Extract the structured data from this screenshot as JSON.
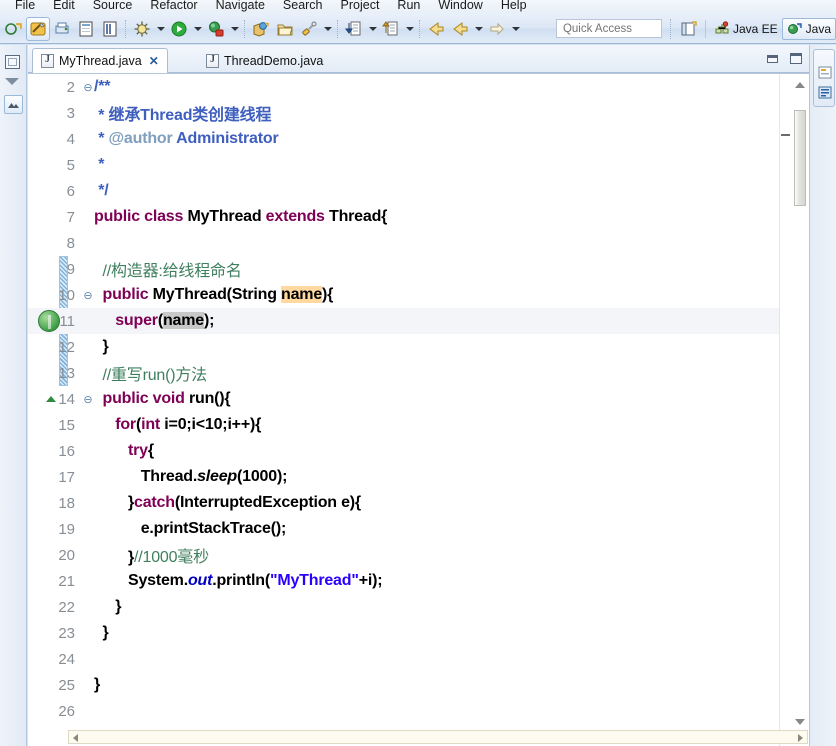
{
  "menu": {
    "items": [
      "File",
      "Edit",
      "Source",
      "Refactor",
      "Navigate",
      "Search",
      "Project",
      "Run",
      "Window",
      "Help"
    ]
  },
  "toolbar": {
    "icons": [
      {
        "name": "new-wizard-icon",
        "glyph": "new"
      },
      {
        "name": "save-icon",
        "glyph": "save"
      },
      {
        "name": "print-icon",
        "glyph": "print"
      },
      {
        "name": "new-java-project-icon",
        "glyph": "project"
      },
      {
        "name": "new-java-package-icon",
        "glyph": "package"
      },
      {
        "name": "debug-icon",
        "glyph": "debug"
      },
      {
        "name": "run-icon",
        "glyph": "run"
      },
      {
        "name": "external-tools-icon",
        "glyph": "external"
      },
      {
        "name": "new-java-class-icon",
        "glyph": "class"
      },
      {
        "name": "open-type-icon",
        "glyph": "opentype"
      },
      {
        "name": "search-icon",
        "glyph": "search"
      },
      {
        "name": "next-annotation-icon",
        "glyph": "next-anno"
      },
      {
        "name": "previous-annotation-icon",
        "glyph": "prev-anno"
      },
      {
        "name": "back-icon",
        "glyph": "back"
      },
      {
        "name": "forward-icon",
        "glyph": "forward"
      },
      {
        "name": "next-edit-icon",
        "glyph": "next-edit"
      }
    ],
    "quick_access_placeholder": "Quick Access"
  },
  "perspectives": {
    "open_perspective_label": "",
    "items": [
      {
        "name": "java-ee-perspective",
        "label": "Java EE",
        "active": false
      },
      {
        "name": "java-perspective",
        "label": "Java",
        "active": true
      }
    ]
  },
  "editor": {
    "tabs": [
      {
        "label": "MyThread.java",
        "active": true,
        "close": "✕"
      },
      {
        "label": "ThreadDemo.java",
        "active": false,
        "close": ""
      }
    ],
    "tab_tools": [
      {
        "name": "minimize-editor-button",
        "title": "Minimize"
      },
      {
        "name": "maximize-editor-button",
        "title": "Maximize"
      }
    ]
  },
  "code": {
    "lines": [
      {
        "num": "2",
        "fold": "⊖",
        "html": "<span class=\"jdoc\">/**</span>"
      },
      {
        "num": "3",
        "fold": "",
        "html": "<span class=\"jdoc\"> * 继承Thread类创建线程</span>"
      },
      {
        "num": "4",
        "fold": "",
        "html": "<span class=\"jdoc\"> * </span><span class=\"jtag\">@author</span><span class=\"jdoc\"> Administrator</span>"
      },
      {
        "num": "5",
        "fold": "",
        "html": "<span class=\"jdoc\"> *</span>"
      },
      {
        "num": "6",
        "fold": "",
        "html": "<span class=\"jdoc\"> */</span>"
      },
      {
        "num": "7",
        "fold": "",
        "html": "<span class=\"kw\">public class</span><span class=\"id\"> MyThread </span><span class=\"kw\">extends</span><span class=\"id\"> Thread{</span>"
      },
      {
        "num": "8",
        "fold": "",
        "html": ""
      },
      {
        "num": "9",
        "fold": "",
        "html": "  <span class=\"cmt\">//构造器:给线程命名</span>"
      },
      {
        "num": "10",
        "fold": "⊖",
        "html": "  <span class=\"kw\">public</span><span class=\"id\"> MyThread(String </span><span class=\"id hl-occ\">name</span><span class=\"id\">){</span>"
      },
      {
        "num": "11",
        "fold": "",
        "html": "     <span class=\"kw\">super</span><span class=\"id\">(</span><span class=\"id hl-sel\">name</span><span class=\"id\">);</span>"
      },
      {
        "num": "12",
        "fold": "",
        "html": "  <span class=\"id\">}</span>"
      },
      {
        "num": "13",
        "fold": "",
        "html": "  <span class=\"cmt\">//重写run()方法</span>"
      },
      {
        "num": "14",
        "fold": "⊖",
        "html": "  <span class=\"kw\">public void</span><span class=\"id\"> run(){</span>"
      },
      {
        "num": "15",
        "fold": "",
        "html": "     <span class=\"kw\">for</span><span class=\"id\">(</span><span class=\"kw\">int</span><span class=\"id\"> i=0;i&lt;10;i++){</span>"
      },
      {
        "num": "16",
        "fold": "",
        "html": "        <span class=\"kw\">try</span><span class=\"id\">{</span>"
      },
      {
        "num": "17",
        "fold": "",
        "html": "           <span class=\"id\">Thread.</span><span class=\"stm\">sleep</span><span class=\"id\">(1000);</span>"
      },
      {
        "num": "18",
        "fold": "",
        "html": "        <span class=\"id\">}</span><span class=\"kw\">catch</span><span class=\"id\">(InterruptedException e){</span>"
      },
      {
        "num": "19",
        "fold": "",
        "html": "           <span class=\"id\">e.printStackTrace();</span>"
      },
      {
        "num": "20",
        "fold": "",
        "html": "        <span class=\"id\">}</span><span class=\"cmt\">//1000毫秒</span>"
      },
      {
        "num": "21",
        "fold": "",
        "html": "        <span class=\"id\">System.</span><span class=\"fld\">out</span><span class=\"id\">.println(</span><span class=\"str\">\"MyThread\"</span><span class=\"id\">+i);</span>"
      },
      {
        "num": "22",
        "fold": "",
        "html": "     <span class=\"id\">}</span>"
      },
      {
        "num": "23",
        "fold": "",
        "html": "  <span class=\"id\">}</span>"
      },
      {
        "num": "24",
        "fold": "",
        "html": ""
      },
      {
        "num": "25",
        "fold": "",
        "html": "<span class=\"id\">}</span>"
      },
      {
        "num": "26",
        "fold": "",
        "html": ""
      }
    ],
    "highlighted_line_index": 9,
    "breakpoint_line_index": 9,
    "override_marker_line_index": 12,
    "change_bar_start_index": 7,
    "change_bar_end_index": 11
  },
  "colors": {
    "keyword": "#7f0055",
    "comment": "#3f7f5f",
    "javadoc": "#3f5fbf",
    "string": "#2a00ff",
    "field": "#0000c0",
    "occurrence_highlight": "#ffd9a0",
    "selection_highlight": "#c8c8c8",
    "chrome": "#d6e3f3"
  },
  "sidebars": {
    "left": [
      {
        "name": "restore-view-button"
      },
      {
        "name": "minimize-view-button"
      },
      {
        "name": "package-explorer-icon"
      }
    ],
    "right": [
      {
        "name": "outline-view-icon"
      },
      {
        "name": "task-list-icon"
      }
    ]
  }
}
